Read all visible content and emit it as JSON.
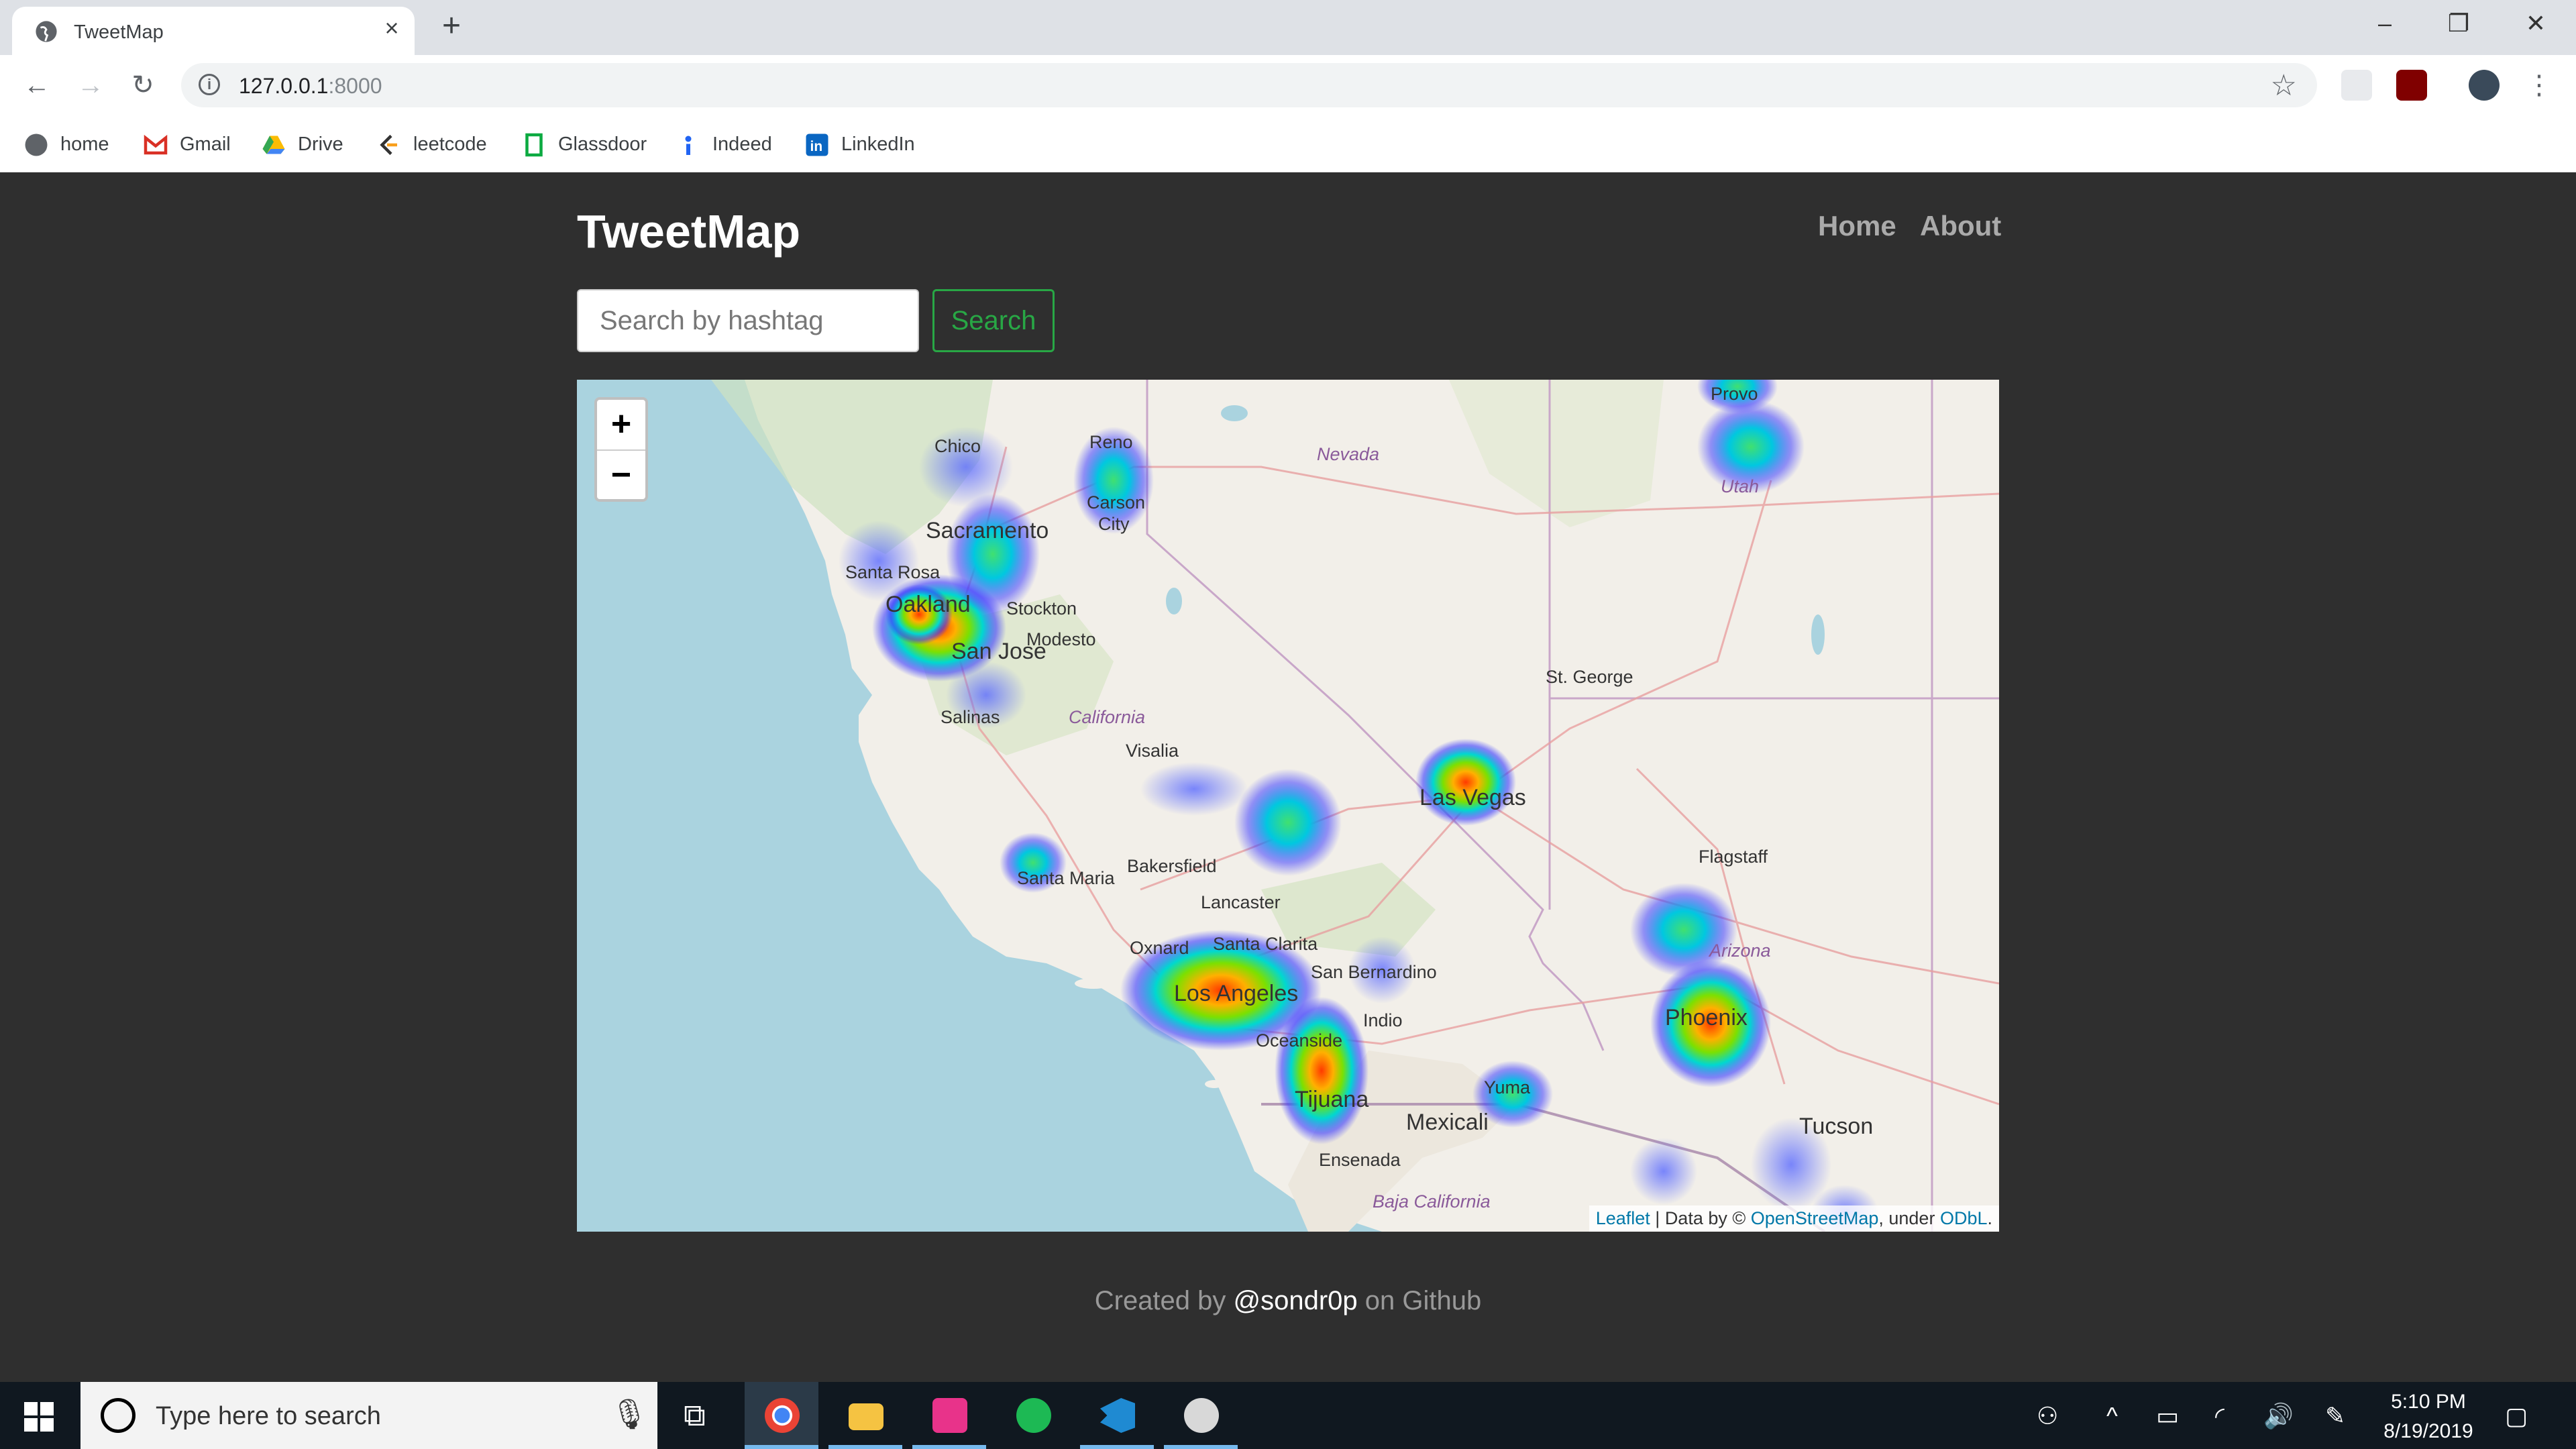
{
  "browser": {
    "tab_title": "TweetMap",
    "url_host": "127.0.0.1",
    "url_port": ":8000",
    "bookmarks": [
      "home",
      "Gmail",
      "Drive",
      "leetcode",
      "Glassdoor",
      "Indeed",
      "LinkedIn"
    ]
  },
  "page": {
    "brand": "TweetMap",
    "nav": {
      "home": "Home",
      "about": "About"
    },
    "search": {
      "placeholder": "Search by hashtag",
      "button": "Search"
    },
    "map": {
      "zoom_in": "+",
      "zoom_out": "−",
      "attribution": {
        "leaflet": "Leaflet",
        "data_by": " | Data by © ",
        "osm": "OpenStreetMap",
        "under": ", under ",
        "odbl": "ODbL",
        "end": "."
      },
      "labels": {
        "chico": "Chico",
        "reno": "Reno",
        "carson": "Carson",
        "city": "City",
        "nevada": "Nevada",
        "provo": "Provo",
        "utah": "Utah",
        "sacramento": "Sacramento",
        "santa_rosa": "Santa Rosa",
        "oakland": "Oakland",
        "stockton": "Stockton",
        "modesto": "Modesto",
        "san_jose": "San Jose",
        "st_george": "St. George",
        "salinas": "Salinas",
        "california": "California",
        "visalia": "Visalia",
        "las_vegas": "Las Vegas",
        "bakersfield": "Bakersfield",
        "flagstaff": "Flagstaff",
        "santa_maria": "Santa Maria",
        "lancaster": "Lancaster",
        "oxnard": "Oxnard",
        "santa_clarita": "Santa Clarita",
        "san_bernardino": "San Bernardino",
        "arizona": "Arizona",
        "los_angeles": "Los Angeles",
        "indio": "Indio",
        "phoenix": "Phoenix",
        "oceanside": "Oceanside",
        "yuma": "Yuma",
        "tijuana": "Tijuana",
        "mexicali": "Mexicali",
        "tucson": "Tucson",
        "ensenada": "Ensenada",
        "baja_california": "Baja California"
      }
    },
    "footer": {
      "prefix": "Created by ",
      "handle": "@sondr0p",
      "suffix": " on Github"
    }
  },
  "taskbar": {
    "search_placeholder": "Type here to search",
    "time": "5:10 PM",
    "date": "8/19/2019"
  }
}
